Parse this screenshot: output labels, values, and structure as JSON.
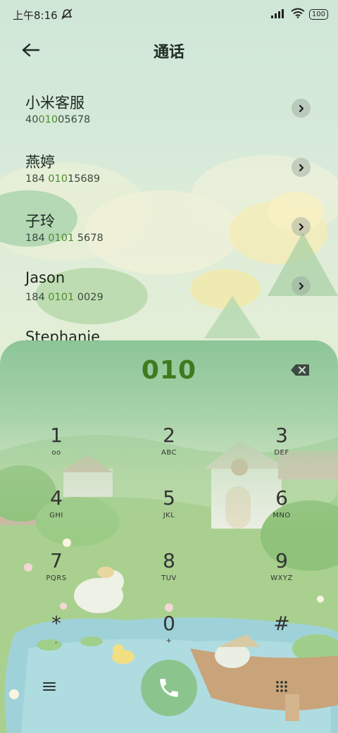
{
  "status_bar": {
    "time": "上午8:16",
    "battery": "100",
    "icons": [
      "notification-muted-icon",
      "signal-icon",
      "wifi-icon",
      "battery-icon"
    ]
  },
  "header": {
    "title": "通话",
    "back_icon": "arrow-left-icon"
  },
  "contacts": [
    {
      "name": "小米客服",
      "number_pre": "40",
      "number_hl": "010",
      "number_post": "05678"
    },
    {
      "name": "燕婷",
      "number_pre": "184 ",
      "number_hl": "010",
      "number_post": "15689"
    },
    {
      "name": "子玲",
      "number_pre": "184 ",
      "number_hl": "0101",
      "number_post": " 5678"
    },
    {
      "name": "Jason",
      "number_pre": "184 ",
      "number_hl": "0101",
      "number_post": " 0029"
    },
    {
      "name": "Stephanie",
      "number_pre": "",
      "number_hl": "",
      "number_post": ""
    }
  ],
  "dialer": {
    "entered_number": "010",
    "keys": [
      {
        "digit": "1",
        "letters": "oo"
      },
      {
        "digit": "2",
        "letters": "ABC"
      },
      {
        "digit": "3",
        "letters": "DEF"
      },
      {
        "digit": "4",
        "letters": "GHI"
      },
      {
        "digit": "5",
        "letters": "JKL"
      },
      {
        "digit": "6",
        "letters": "MNO"
      },
      {
        "digit": "7",
        "letters": "PQRS"
      },
      {
        "digit": "8",
        "letters": "TUV"
      },
      {
        "digit": "9",
        "letters": "WXYZ"
      },
      {
        "digit": "*",
        "letters": ","
      },
      {
        "digit": "0",
        "letters": "+"
      },
      {
        "digit": "#",
        "letters": ""
      }
    ]
  },
  "colors": {
    "accent_green": "#4e8a2e",
    "call_button": "#8cc48e",
    "dialer_top": "#8ac496"
  }
}
